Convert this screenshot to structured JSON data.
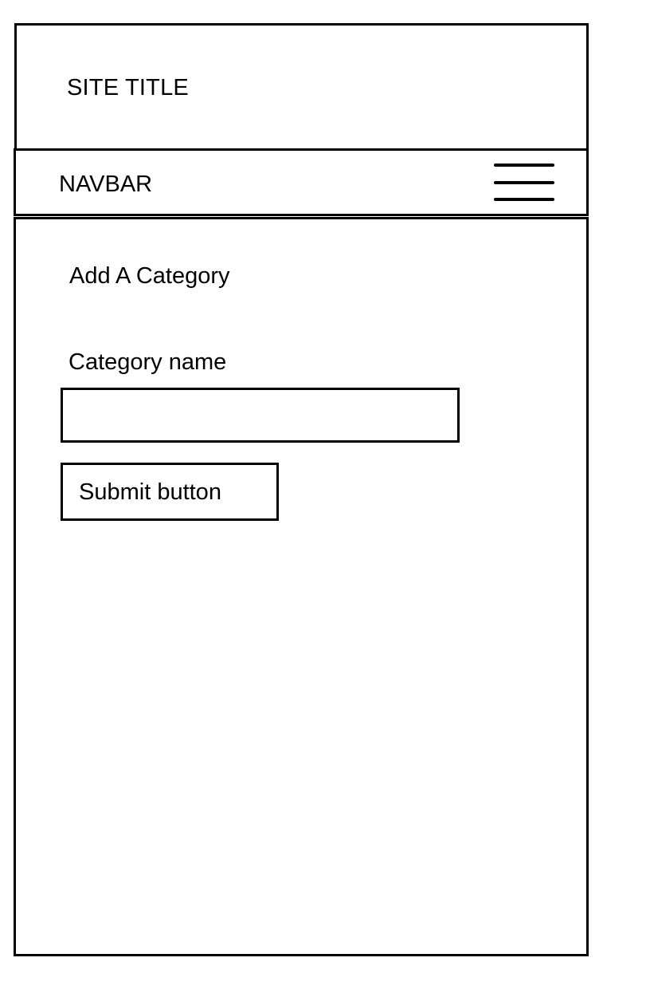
{
  "header": {
    "site_title": "SITE TITLE"
  },
  "navbar": {
    "label": "NAVBAR",
    "menu_icon": "hamburger-menu-icon"
  },
  "main": {
    "heading": "Add A Category",
    "form": {
      "field_label": "Category name",
      "field_value": "",
      "submit_label": "Submit button"
    }
  }
}
